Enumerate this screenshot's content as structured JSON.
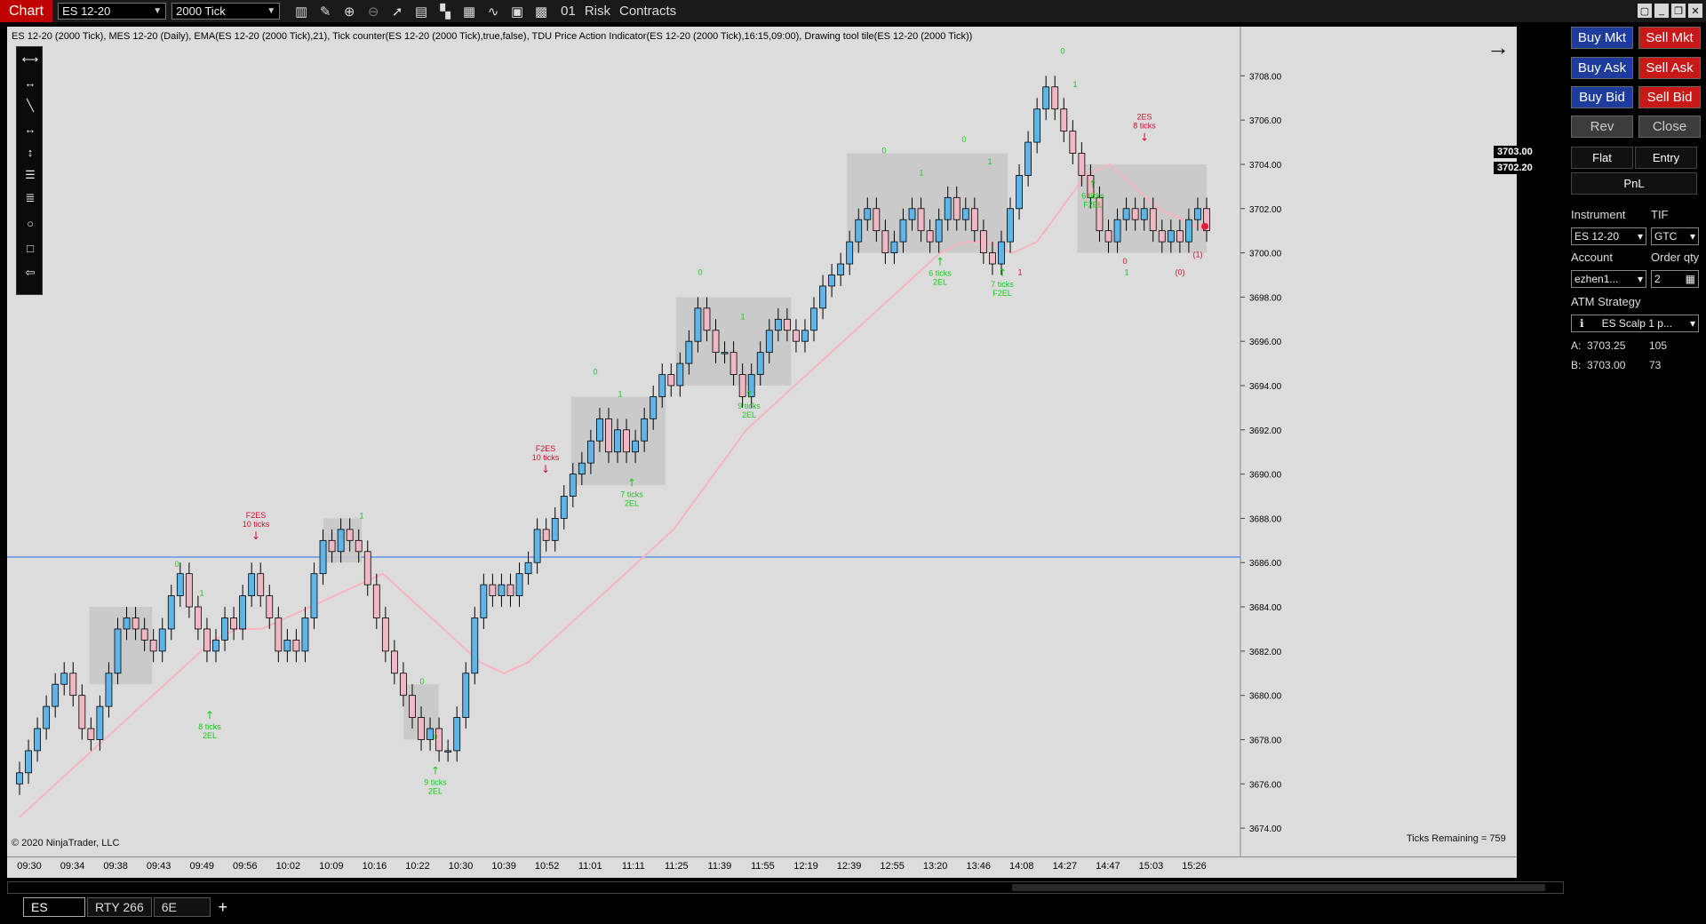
{
  "toolbar": {
    "chart_label": "Chart",
    "instrument": "ES 12-20",
    "period": "2000 Tick",
    "icons": [
      "bar-type-icon",
      "draw-icon",
      "zoom-in-icon",
      "zoom-out-icon",
      "pointer-icon",
      "data-box-icon",
      "template-icon",
      "indicators-icon",
      "strategies-icon",
      "properties-icon",
      "chart-trader-icon"
    ],
    "count_label": "01",
    "risk_label": "Risk",
    "contracts_label": "Contracts"
  },
  "chart": {
    "indicator_line": "ES 12-20 (2000 Tick), MES 12-20 (Daily), EMA(ES 12-20 (2000 Tick),21), Tick counter(ES 12-20 (2000 Tick),true,false), TDU Price Action Indicator(ES 12-20 (2000 Tick),16:15,09:00), Drawing tool tile(ES 12-20 (2000 Tick))",
    "copyright": "© 2020 NinjaTrader, LLC",
    "ticks_remaining": "Ticks Remaining = 759",
    "ask_badge": "3703.00",
    "bid_badge": "3702.20",
    "colors": {
      "background": "#dcdcdc",
      "up_candle": "#5fb5e8",
      "down_candle": "#f0b8c4",
      "ema": "#f7b4c0",
      "horizontal_line": "#4a86e8",
      "box": "#c8c8c8",
      "long_signal": "#18c818",
      "short_signal": "#d01030"
    }
  },
  "chart_data": {
    "type": "candlestick",
    "instrument": "ES 12-20",
    "period": "2000 Tick",
    "y_ticks": [
      "3674.00",
      "3676.00",
      "3678.00",
      "3680.00",
      "3682.00",
      "3684.00",
      "3686.00",
      "3688.00",
      "3690.00",
      "3692.00",
      "3694.00",
      "3696.00",
      "3698.00",
      "3700.00",
      "3702.00",
      "3704.00",
      "3706.00",
      "3708.00"
    ],
    "ylim": [
      3673.2,
      3709.5
    ],
    "x_ticks": [
      "09:30",
      "09:34",
      "09:38",
      "09:43",
      "09:49",
      "09:56",
      "10:02",
      "10:09",
      "10:16",
      "10:22",
      "10:30",
      "10:39",
      "10:52",
      "11:01",
      "11:11",
      "11:25",
      "11:39",
      "11:55",
      "12:19",
      "12:39",
      "12:55",
      "13:20",
      "13:46",
      "14:08",
      "14:27",
      "14:47",
      "15:03",
      "15:26"
    ],
    "horizontal_line": 3686.25,
    "close_path": [
      3676.5,
      3677.5,
      3678.5,
      3679.5,
      3680.5,
      3681.0,
      3680.0,
      3678.5,
      3678.0,
      3679.5,
      3681.0,
      3683.0,
      3683.5,
      3683.0,
      3682.5,
      3682.0,
      3683.0,
      3684.5,
      3685.5,
      3684.0,
      3683.0,
      3682.0,
      3682.5,
      3683.5,
      3683.0,
      3684.5,
      3685.5,
      3684.5,
      3683.5,
      3682.0,
      3682.5,
      3682.0,
      3683.5,
      3685.5,
      3687.0,
      3686.5,
      3687.5,
      3687.0,
      3686.5,
      3685.0,
      3683.5,
      3682.0,
      3681.0,
      3680.0,
      3679.0,
      3678.0,
      3678.5,
      3677.5,
      3677.5,
      3679.0,
      3681.0,
      3683.5,
      3685.0,
      3684.5,
      3685.0,
      3684.5,
      3685.5,
      3686.0,
      3687.5,
      3687.0,
      3688.0,
      3689.0,
      3690.0,
      3690.5,
      3691.5,
      3692.5,
      3691.0,
      3692.0,
      3691.0,
      3691.5,
      3692.5,
      3693.5,
      3694.5,
      3694.0,
      3695.0,
      3696.0,
      3697.5,
      3696.5,
      3695.5,
      3695.5,
      3694.5,
      3693.5,
      3694.5,
      3695.5,
      3696.5,
      3697.0,
      3696.5,
      3696.0,
      3696.5,
      3697.5,
      3698.5,
      3699.0,
      3699.5,
      3700.5,
      3701.5,
      3702.0,
      3701.0,
      3700.0,
      3700.5,
      3701.5,
      3702.0,
      3701.0,
      3700.5,
      3701.5,
      3702.5,
      3701.5,
      3702.0,
      3701.0,
      3700.0,
      3699.5,
      3700.5,
      3702.0,
      3703.5,
      3705.0,
      3706.5,
      3707.5,
      3706.5,
      3705.5,
      3704.5,
      3703.5,
      3702.5,
      3701.0,
      3700.5,
      3701.5,
      3702.0,
      3701.5,
      3702.0,
      3701.0,
      3700.5,
      3701.0,
      3700.5,
      3701.5,
      3702.0,
      3701.0
    ],
    "ema_path": [
      3674.5,
      3675.5,
      3676.5,
      3677.5,
      3678.5,
      3679.5,
      3680.5,
      3681.5,
      3682.5,
      3683.0,
      3683.0,
      3683.5,
      3684.0,
      3684.5,
      3685.0,
      3685.5,
      3684.5,
      3683.5,
      3682.5,
      3681.5,
      3681.0,
      3681.5,
      3682.5,
      3683.5,
      3684.5,
      3685.5,
      3686.5,
      3687.5,
      3689.0,
      3690.5,
      3692.0,
      3693.0,
      3694.0,
      3695.0,
      3696.0,
      3697.0,
      3698.0,
      3699.0,
      3700.0,
      3700.5,
      3700.5,
      3700.0,
      3700.5,
      3702.0,
      3703.5,
      3704.0,
      3703.0,
      3702.0,
      3701.5,
      3701.0
    ],
    "boxes": [
      {
        "t1": 3684.0,
        "t2": 3680.5,
        "label": ""
      },
      {
        "t1": 3688.0,
        "t2": 3686.0,
        "label": ""
      },
      {
        "t1": 3680.5,
        "t2": 3678.0,
        "label": ""
      },
      {
        "t1": 3693.5,
        "t2": 3689.5,
        "label": ""
      },
      {
        "t1": 3698.0,
        "t2": 3694.0,
        "label": ""
      },
      {
        "t1": 3704.5,
        "t2": 3700.0,
        "label": ""
      },
      {
        "t1": 3704.0,
        "t2": 3700.0,
        "label": ""
      }
    ],
    "signals": [
      {
        "kind": "short",
        "label": "F2ES\n10 ticks",
        "price": 3686.5
      },
      {
        "kind": "long",
        "label": "8 ticks\n2EL",
        "price": 3679.5
      },
      {
        "kind": "long",
        "label": "9 ticks\n2EL",
        "price": 3677.0
      },
      {
        "kind": "short",
        "label": "F2ES\n10 ticks",
        "price": 3689.5
      },
      {
        "kind": "long",
        "label": "7 ticks\n2EL",
        "price": 3690.0
      },
      {
        "kind": "long",
        "label": "9 ticks\n2EL",
        "price": 3694.0
      },
      {
        "kind": "long",
        "label": "6 ticks\n2EL",
        "price": 3700.0
      },
      {
        "kind": "long",
        "label": "7 ticks\nF2EL",
        "price": 3699.5
      },
      {
        "kind": "long",
        "label": "6 ticks\nF2EL",
        "price": 3703.5
      },
      {
        "kind": "short",
        "label": "2ES\n8 ticks",
        "price": 3704.5
      }
    ],
    "counters": [
      "0",
      "1",
      "1",
      "0",
      "0",
      "0",
      "1",
      "0",
      "1",
      "0",
      "1",
      "0",
      "1",
      "0",
      "1",
      "1",
      "0",
      "1",
      "(0)",
      "(1)"
    ]
  },
  "order_panel": {
    "buy_mkt": "Buy Mkt",
    "sell_mkt": "Sell Mkt",
    "buy_ask": "Buy Ask",
    "sell_ask": "Sell Ask",
    "buy_bid": "Buy Bid",
    "sell_bid": "Sell Bid",
    "rev": "Rev",
    "close": "Close",
    "flat": "Flat",
    "entry": "Entry",
    "pnl": "PnL",
    "instrument_label": "Instrument",
    "tif_label": "TIF",
    "instrument_value": "ES 12-20",
    "tif_value": "GTC",
    "account_label": "Account",
    "order_qty_label": "Order qty",
    "account_value": "ezhen1...",
    "order_qty_value": "2",
    "atm_label": "ATM Strategy",
    "atm_value": "ES Scalp 1 p...",
    "ask_row_label": "A:",
    "ask_price": "3703.25",
    "ask_size": "105",
    "bid_row_label": "B:",
    "bid_price": "3703.00",
    "bid_size": "73"
  },
  "tabs": [
    "ES",
    "RTY 266",
    "6E"
  ],
  "add_tab": "+"
}
